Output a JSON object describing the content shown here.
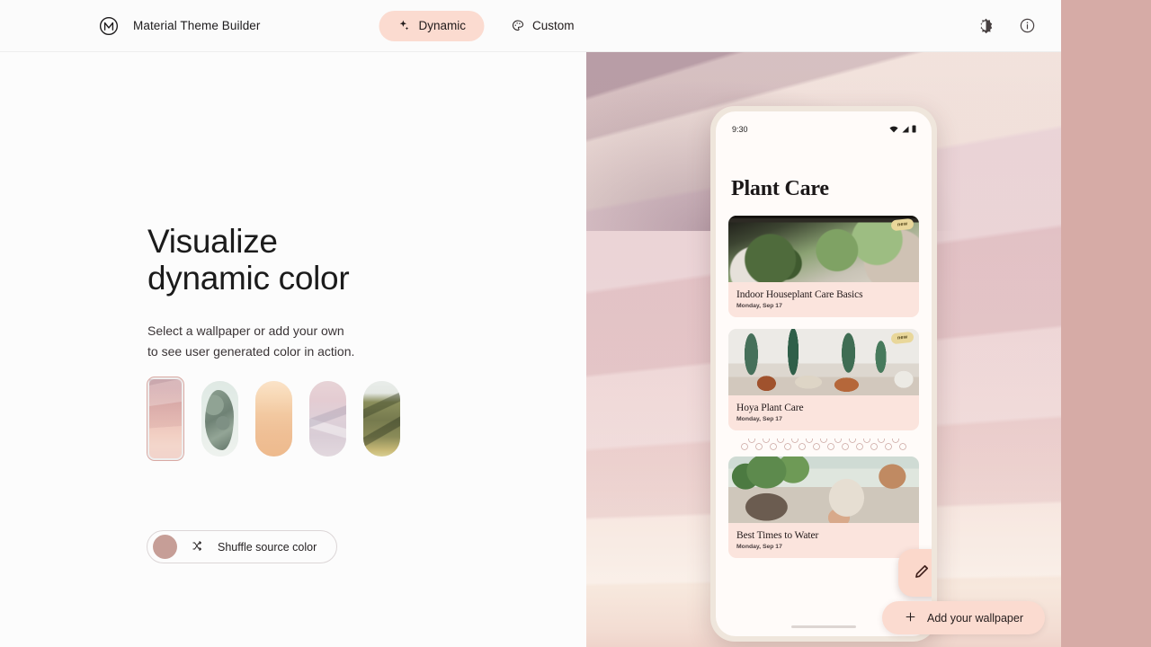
{
  "header": {
    "logo_icon": "material-m-logo",
    "title": "Material Theme Builder",
    "tabs": [
      {
        "label": "Dynamic",
        "icon": "sparkle-icon",
        "active": true
      },
      {
        "label": "Custom",
        "icon": "palette-icon",
        "active": false
      }
    ],
    "actions": [
      {
        "name": "theme-mode-toggle",
        "icon": "brightness-icon"
      },
      {
        "name": "info-button",
        "icon": "info-circle-icon"
      }
    ]
  },
  "hero": {
    "title_line1": "Visualize",
    "title_line2": "dynamic color",
    "subtitle_line1": "Select a wallpaper or add your own",
    "subtitle_line2": "to see user generated color in action."
  },
  "wallpapers": [
    {
      "name": "pink-dunes",
      "selected": true
    },
    {
      "name": "green-stone",
      "selected": false
    },
    {
      "name": "peach-gradient",
      "selected": false
    },
    {
      "name": "lavender-mountains",
      "selected": false
    },
    {
      "name": "olive-hills",
      "selected": false
    }
  ],
  "shuffle": {
    "label": "Shuffle source color",
    "icon": "shuffle-icon",
    "source_color": "#c69e97"
  },
  "phone": {
    "status_bar": {
      "time": "9:30",
      "icons": [
        "wifi-icon",
        "signal-icon",
        "battery-icon"
      ]
    },
    "app_title": "Plant Care",
    "cards": [
      {
        "title": "Indoor Houseplant Care Basics",
        "date": "Monday, Sep 17",
        "badge": "new"
      },
      {
        "title": "Hoya Plant Care",
        "date": "Monday, Sep 17",
        "badge": "new"
      },
      {
        "title": "Best Times to Water",
        "date": "Monday, Sep 17",
        "badge": ""
      }
    ],
    "fab": {
      "icon": "edit-pencil-icon"
    }
  },
  "add_wallpaper": {
    "label": "Add your wallpaper",
    "icon": "plus-icon"
  },
  "colors": {
    "accent_pill": "#fbdbd0",
    "card_surface": "#fbe4dd",
    "side_strip": "#d6aba6",
    "badge": "#e9d79a"
  }
}
